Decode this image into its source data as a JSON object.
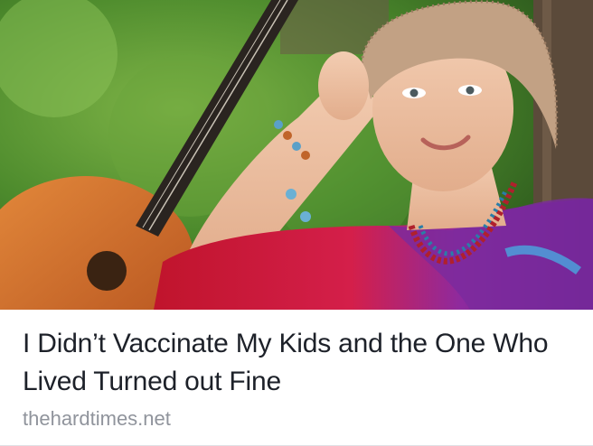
{
  "post": {
    "headline": "I Didn’t Vaccinate My Kids and the One Who Lived Turned out Fine",
    "domain": "thehardtimes.net"
  },
  "image": {
    "subject": "photo"
  }
}
